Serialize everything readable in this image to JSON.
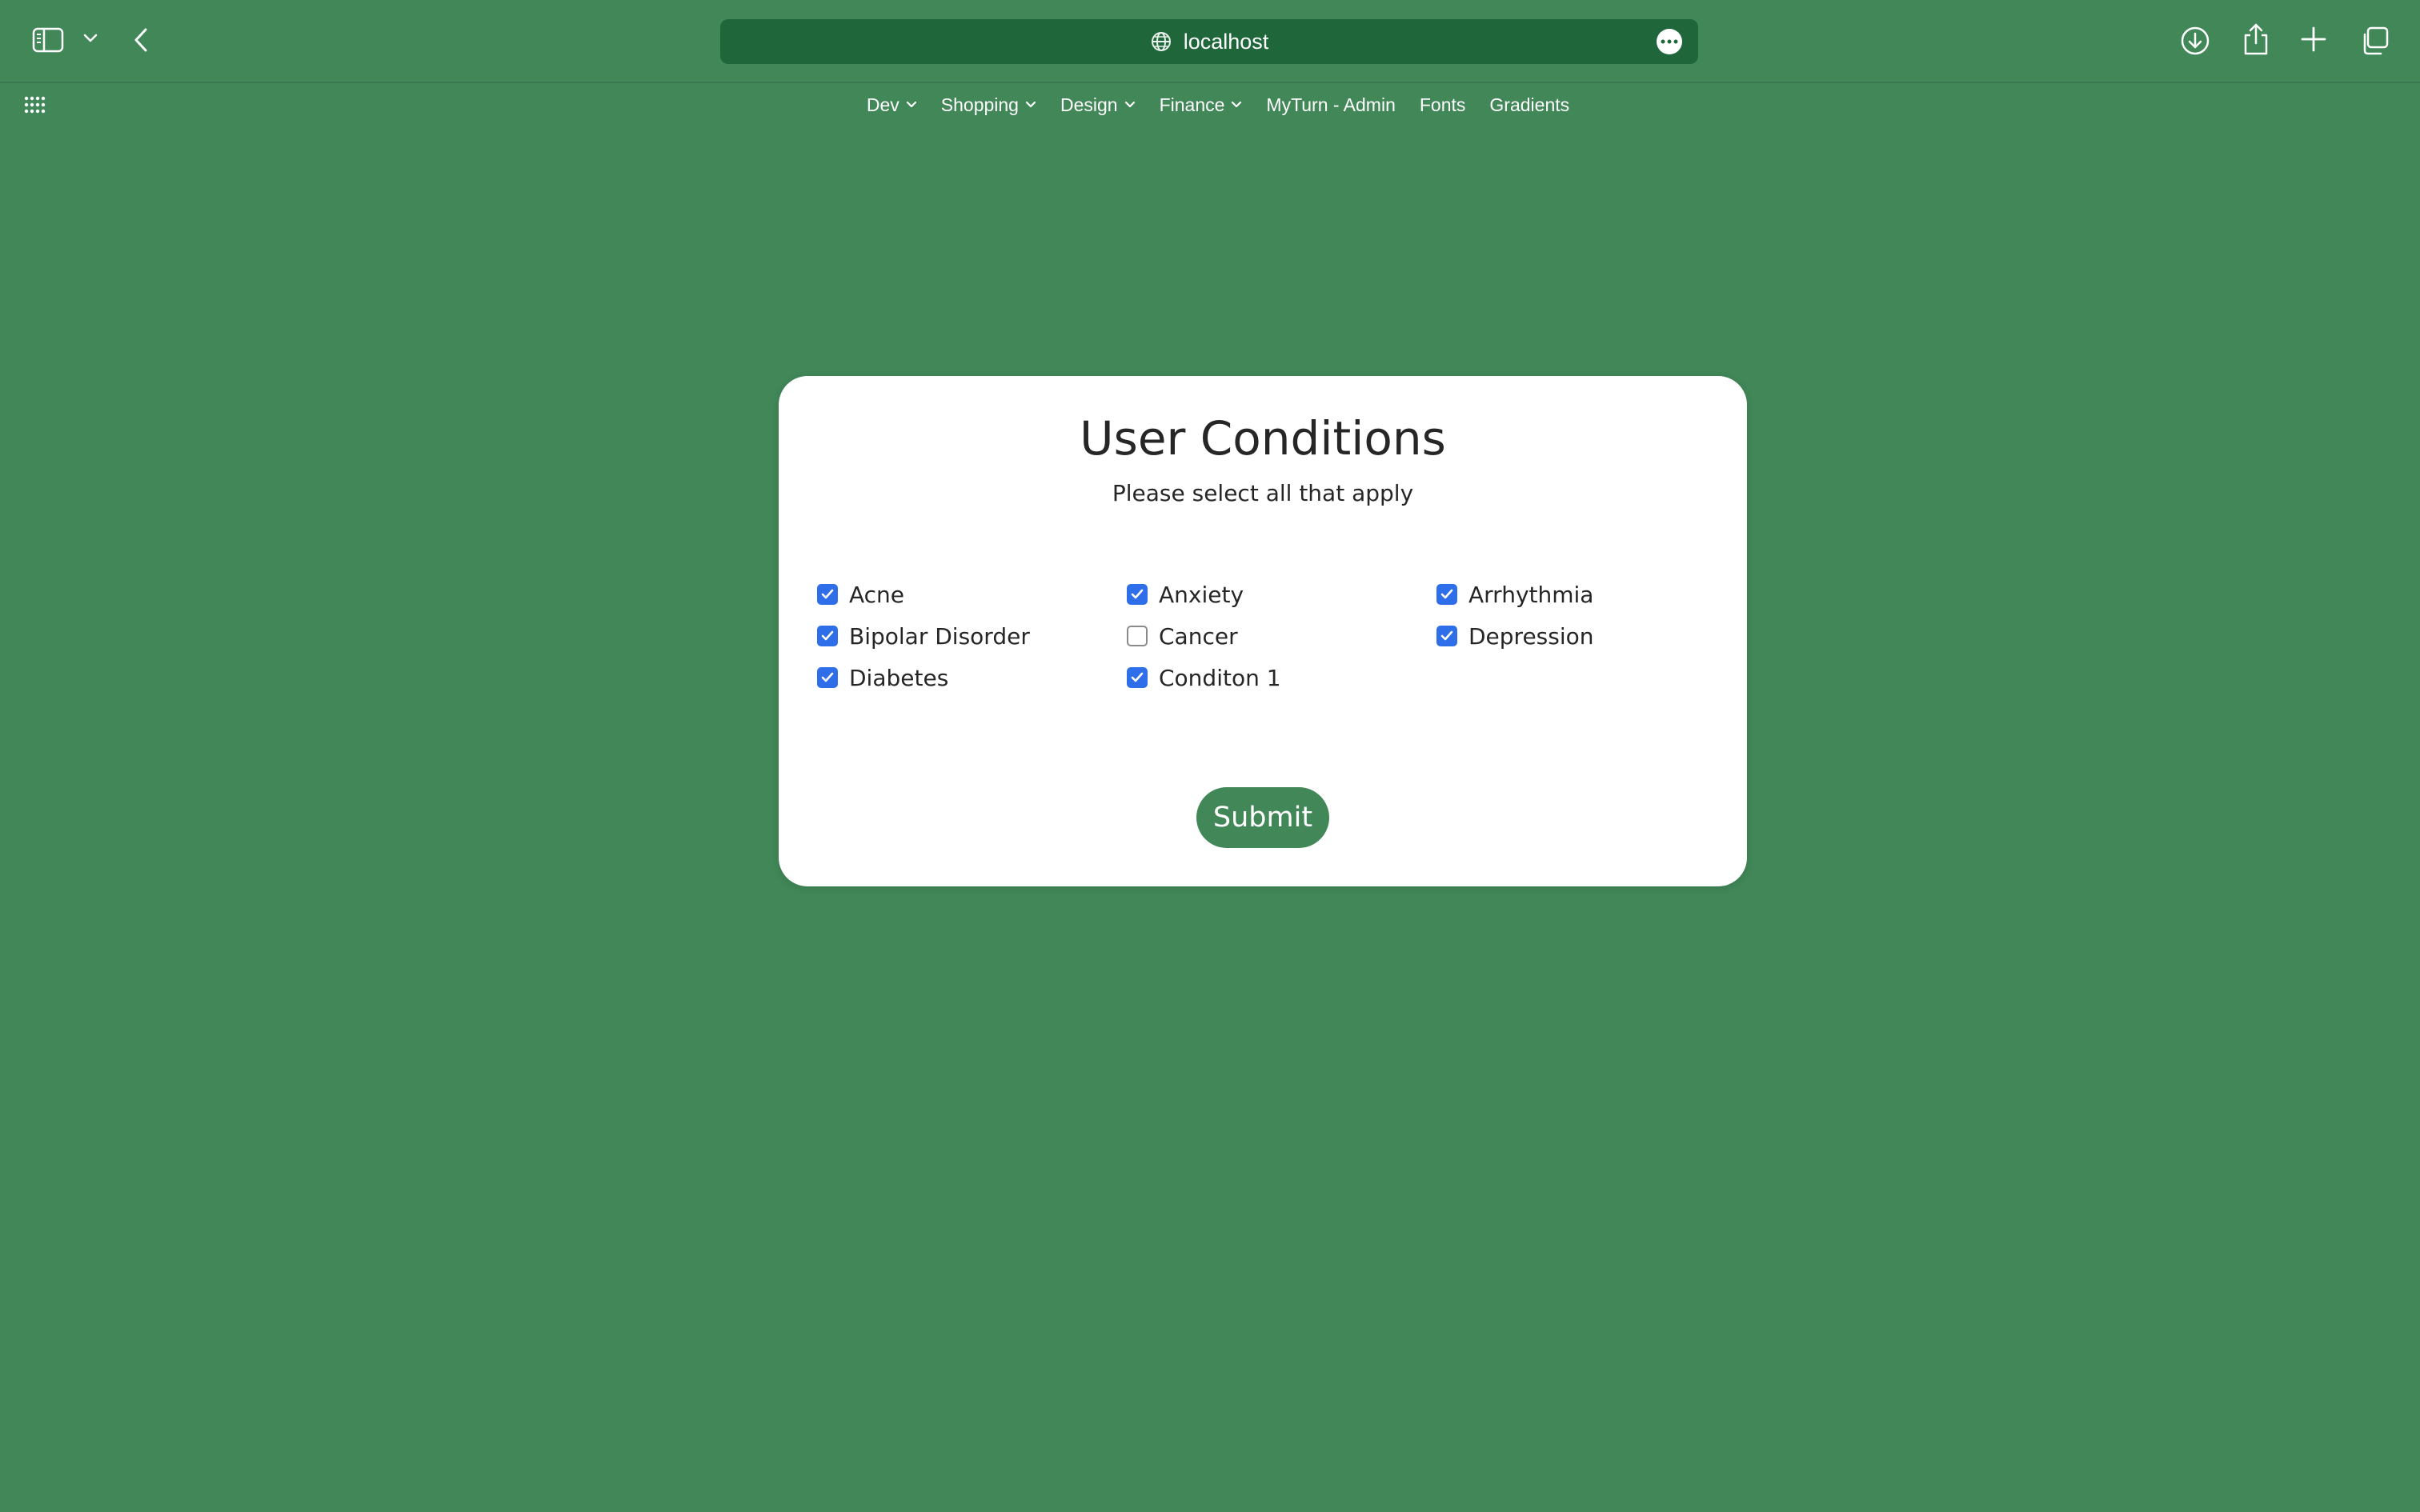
{
  "browser": {
    "address": "localhost",
    "bookmarks": [
      {
        "label": "Dev",
        "has_menu": true
      },
      {
        "label": "Shopping",
        "has_menu": true
      },
      {
        "label": "Design",
        "has_menu": true
      },
      {
        "label": "Finance",
        "has_menu": true
      },
      {
        "label": "MyTurn - Admin",
        "has_menu": false
      },
      {
        "label": "Fonts",
        "has_menu": false
      },
      {
        "label": "Gradients",
        "has_menu": false
      }
    ],
    "icons": [
      "sidebar-icon",
      "chevron-down-icon",
      "back-arrow-icon",
      "globe-icon",
      "more-icon",
      "download-icon",
      "share-icon",
      "plus-icon",
      "tabs-icon",
      "grid-icon"
    ]
  },
  "form": {
    "title": "User Conditions",
    "subtitle": "Please select all that apply",
    "conditions": [
      {
        "label": "Acne",
        "checked": true
      },
      {
        "label": "Anxiety",
        "checked": true
      },
      {
        "label": "Arrhythmia",
        "checked": true
      },
      {
        "label": "Bipolar Disorder",
        "checked": true
      },
      {
        "label": "Cancer",
        "checked": false
      },
      {
        "label": "Depression",
        "checked": true
      },
      {
        "label": "Diabetes",
        "checked": true
      },
      {
        "label": "Conditon 1",
        "checked": true
      }
    ],
    "submit_label": "Submit"
  },
  "colors": {
    "background": "#418758",
    "address_bar": "#1f673a",
    "checkbox_checked": "#2f6ee9",
    "submit_button": "#418758",
    "card": "#ffffff",
    "text": "#262626"
  }
}
